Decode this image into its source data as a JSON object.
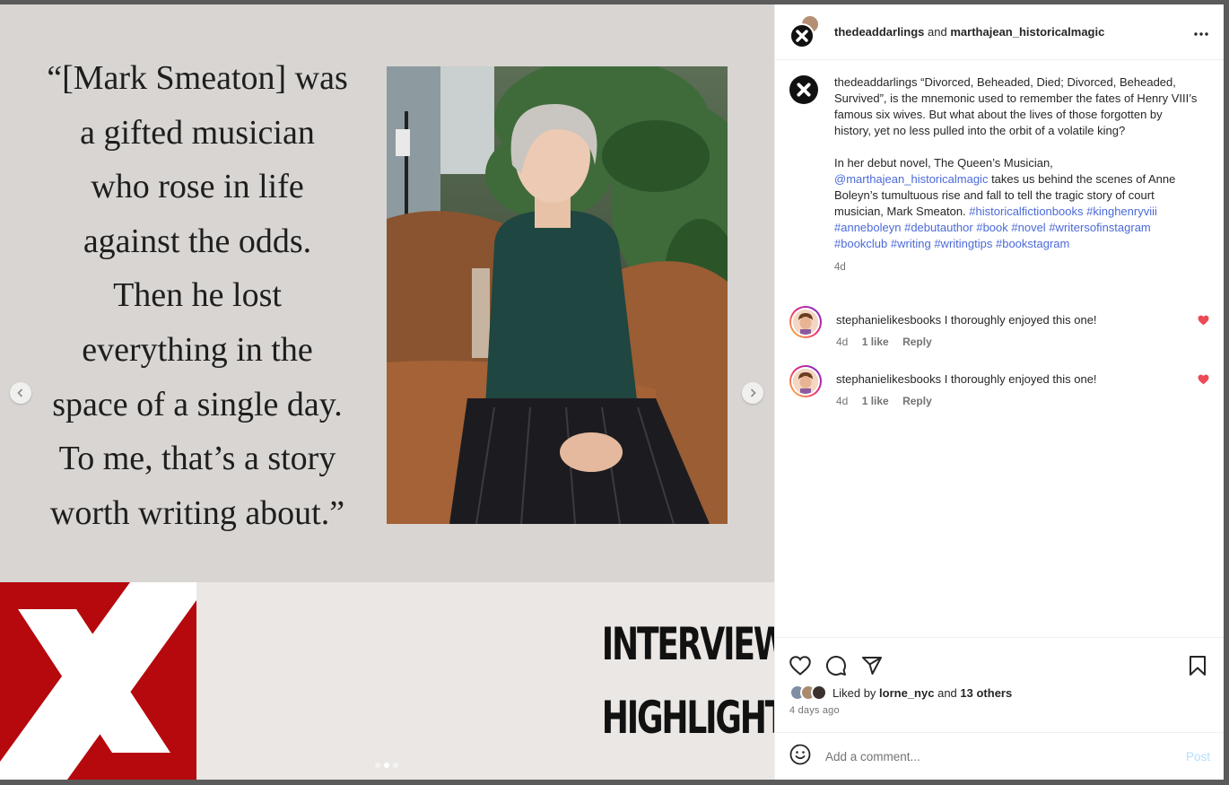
{
  "media": {
    "quote": "“[Mark Smeaton] was a gifted musician who rose in life against the odds. Then he lost everything in the space of a single day. To me, that’s a story worth writing about.”",
    "quote_lines": [
      "“[Mark Smeaton] was",
      "a gifted musician",
      "who rose in life",
      "against the odds.",
      "Then he lost",
      "everything in the",
      "space of a single day.",
      "To me, that’s a story",
      "worth writing about.”"
    ],
    "banner_title_lines": [
      "INTERVIEW",
      "HIGHLIGHTS"
    ],
    "brand_color": "#b5090e",
    "carousel": {
      "total": 3,
      "active_index": 1
    },
    "nav_prev_icon": "chevron-left-icon",
    "nav_next_icon": "chevron-right-icon"
  },
  "header": {
    "user1": "thedeaddarlings",
    "joiner": "and",
    "user2": "marthajean_historicalmagic",
    "more_icon": "more-horizontal-icon"
  },
  "caption": {
    "username": "thedeaddarlings",
    "para1": "“Divorced, Beheaded, Died; Divorced, Beheaded, Survived”, is the mnemonic used to remember the fates of Henry VIII’s famous six wives. But what about the lives of those forgotten by history, yet no less pulled into the orbit of a volatile king?",
    "para2_prefix": "In her debut novel, The Queen’s Musician,",
    "mention": "@marthajean_historicalmagic",
    "para2_middle": "takes us behind the scenes of Anne Boleyn’s tumultuous rise and fall to tell the tragic story of court musician, Mark Smeaton.",
    "hashtags": [
      "#historicalfictionbooks",
      "#kinghenryviii",
      "#anneboleyn",
      "#debutauthor",
      "#book",
      "#novel",
      "#writersofinstagram",
      "#bookclub",
      "#writing",
      "#writingtips",
      "#bookstagram"
    ],
    "age": "4d"
  },
  "comments": [
    {
      "username": "stephanielikesbooks",
      "text": "I thoroughly enjoyed this one!",
      "age": "4d",
      "likes": "1 like",
      "reply": "Reply"
    },
    {
      "username": "stephanielikesbooks",
      "text": "I thoroughly enjoyed this one!",
      "age": "4d",
      "likes": "1 like",
      "reply": "Reply"
    }
  ],
  "actions": {
    "like_icon": "heart-icon",
    "comment_icon": "comment-icon",
    "share_icon": "paper-plane-icon",
    "save_icon": "bookmark-icon"
  },
  "likes": {
    "prefix": "Liked by",
    "user": "lorne_nyc",
    "joiner": "and",
    "others": "13 others"
  },
  "timestamp": "4 days ago",
  "comment_box": {
    "placeholder": "Add a comment...",
    "post_label": "Post",
    "emoji_icon": "smiley-icon"
  }
}
